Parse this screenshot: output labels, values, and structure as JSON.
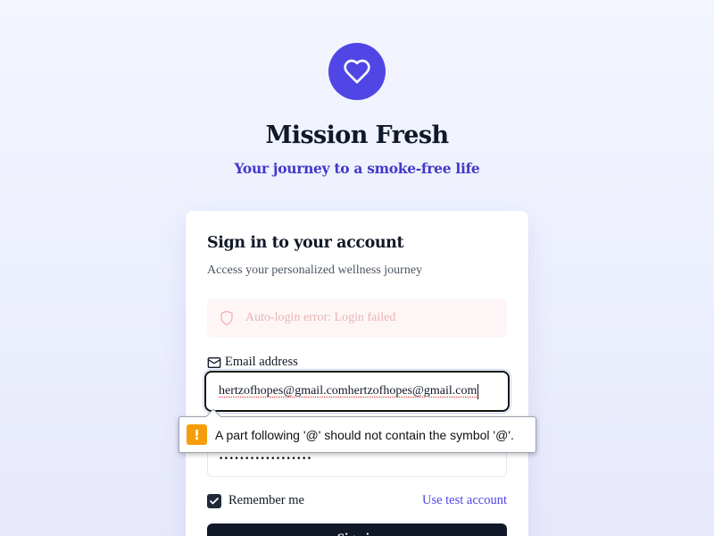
{
  "app": {
    "title": "Mission Fresh",
    "subtitle": "Your journey to a smoke-free life",
    "logo_icon": "heart-icon",
    "accent_color": "#4f46e5"
  },
  "card": {
    "title": "Sign in to your account",
    "description": "Access your personalized wellness journey",
    "error": {
      "icon": "shield-icon",
      "text": "Auto-login error: Login failed"
    },
    "email": {
      "label": "Email address",
      "icon": "mail-icon",
      "value": "hertzofhopes@gmail.comhertzofhopes@gmail.com"
    },
    "password": {
      "value": "••••••••••••••••••"
    },
    "remember_me": {
      "label": "Remember me",
      "checked": true
    },
    "test_account_link": "Use test account",
    "submit_label": "Sign in"
  },
  "validation_tooltip": {
    "icon": "warning-icon",
    "message": "A part following '@' should not contain the symbol '@'."
  }
}
